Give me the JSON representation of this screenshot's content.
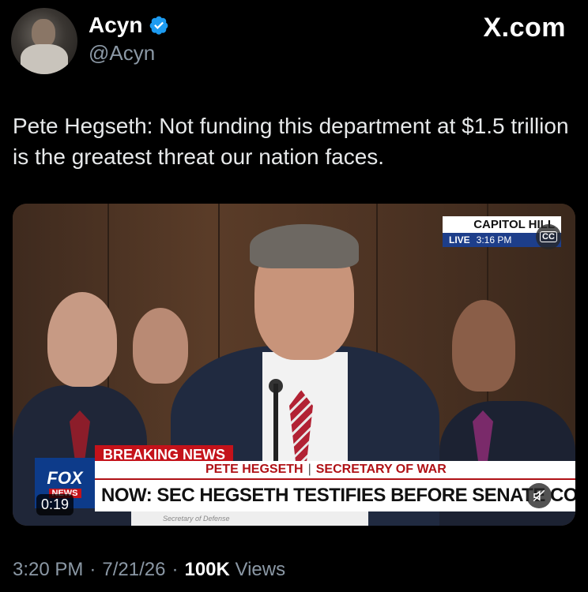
{
  "author": {
    "name": "Acyn",
    "handle": "@Acyn",
    "verified": true
  },
  "site_label": "X.com",
  "tweet": {
    "text": "Pete Hegseth: Not funding this department at $1.5 trillion is the greatest threat our nation faces."
  },
  "video": {
    "timestamp": "0:19",
    "bug": {
      "location": "CAPITOL HILL",
      "live": "LIVE",
      "time": "3:16 PM"
    },
    "chyron": {
      "breaking": "BREAKING NEWS",
      "speaker": "PETE HEGSETH",
      "role": "SECRETARY OF WAR",
      "headline": "NOW: SEC HEGSETH TESTIFIES BEFORE SENATE COMMITTEE",
      "logo": "FOX",
      "logo_sub": "NEWS"
    },
    "nameplate": "Secretary of Defense"
  },
  "meta": {
    "time": "3:20 PM",
    "date": "7/21/26",
    "views_count": "100K",
    "views_label": "Views"
  },
  "colors": {
    "verified_blue": "#1d9bf0",
    "fox_red": "#c4121a",
    "fox_blue": "#0d3b8a"
  }
}
